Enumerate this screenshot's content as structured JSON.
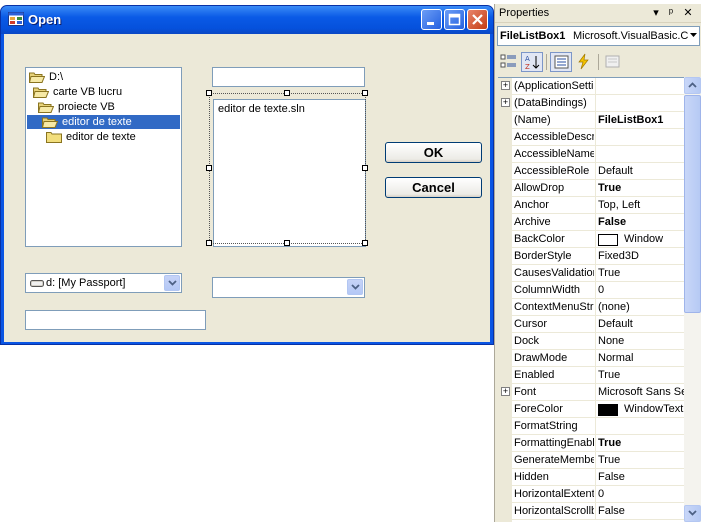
{
  "form": {
    "title": "Open",
    "dir_list": [
      {
        "label": "D:\\",
        "indent": 0,
        "selected": false
      },
      {
        "label": "carte VB lucru",
        "indent": 1,
        "selected": false
      },
      {
        "label": "proiecte VB",
        "indent": 2,
        "selected": false
      },
      {
        "label": "editor de texte",
        "indent": 3,
        "selected": true
      },
      {
        "label": "editor de texte",
        "indent": 4,
        "selected": false
      }
    ],
    "filename_textbox": "",
    "file_list": [
      "editor de texte.sln"
    ],
    "ok_label": "OK",
    "cancel_label": "Cancel",
    "drive_combo": "d: [My Passport]",
    "filter_combo": "",
    "path_textbox": ""
  },
  "properties": {
    "title": "Properties",
    "header_buttons": [
      "▾",
      "ᵖ",
      "✕"
    ],
    "object_name": "FileListBox1",
    "object_type": "Microsoft.VisualBasic.C",
    "rows": [
      {
        "name": "(ApplicationSetti",
        "value": "",
        "expandable": true
      },
      {
        "name": "(DataBindings)",
        "value": "",
        "expandable": true
      },
      {
        "name": "(Name)",
        "value": "FileListBox1",
        "bold": true
      },
      {
        "name": "AccessibleDescri",
        "value": ""
      },
      {
        "name": "AccessibleName",
        "value": ""
      },
      {
        "name": "AccessibleRole",
        "value": "Default"
      },
      {
        "name": "AllowDrop",
        "value": "True",
        "bold": true
      },
      {
        "name": "Anchor",
        "value": "Top, Left"
      },
      {
        "name": "Archive",
        "value": "False",
        "bold": true
      },
      {
        "name": "BackColor",
        "value": "Window",
        "swatch": "#ffffff"
      },
      {
        "name": "BorderStyle",
        "value": "Fixed3D"
      },
      {
        "name": "CausesValidatior",
        "value": "True"
      },
      {
        "name": "ColumnWidth",
        "value": "0"
      },
      {
        "name": "ContextMenuStr",
        "value": "(none)"
      },
      {
        "name": "Cursor",
        "value": "Default"
      },
      {
        "name": "Dock",
        "value": "None"
      },
      {
        "name": "DrawMode",
        "value": "Normal"
      },
      {
        "name": "Enabled",
        "value": "True"
      },
      {
        "name": "Font",
        "value": "Microsoft Sans Se",
        "expandable": true
      },
      {
        "name": "ForeColor",
        "value": "WindowText",
        "swatch": "#000000"
      },
      {
        "name": "FormatString",
        "value": ""
      },
      {
        "name": "FormattingEnabl",
        "value": "True",
        "bold": true
      },
      {
        "name": "GenerateMembe",
        "value": "True"
      },
      {
        "name": "Hidden",
        "value": "False"
      },
      {
        "name": "HorizontalExtent",
        "value": "0"
      },
      {
        "name": "HorizontalScrollb",
        "value": "False"
      }
    ]
  }
}
